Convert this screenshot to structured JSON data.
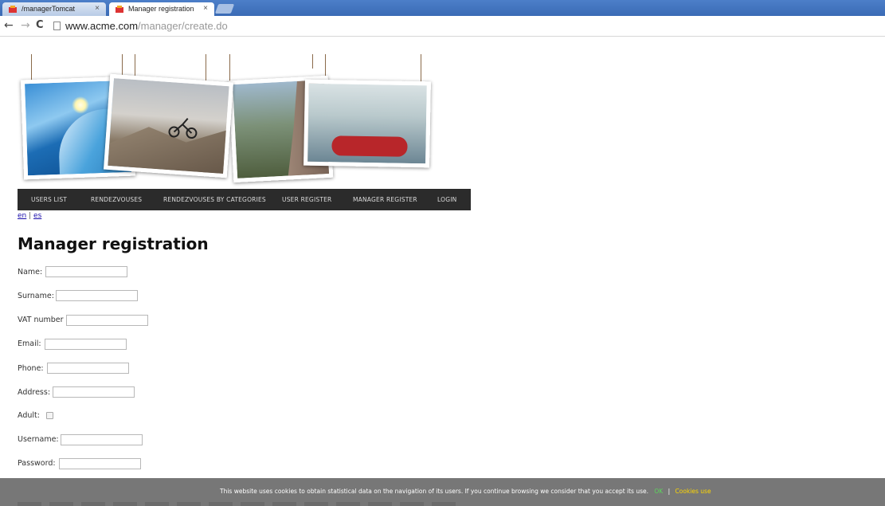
{
  "browser": {
    "tabs": [
      {
        "label": "/managerTomcat",
        "active": false
      },
      {
        "label": "Manager registration",
        "active": true
      }
    ],
    "close_glyph": "×",
    "url_host": "www.acme.com",
    "url_path": "/manager/create.do",
    "icons": {
      "back": "←",
      "forward": "→",
      "reload": "C"
    }
  },
  "menu": {
    "items": [
      {
        "label": "USERS LIST"
      },
      {
        "label": "RENDEZVOUSES"
      },
      {
        "label": "RENDEZVOUSES BY CATEGORIES"
      },
      {
        "label": "USER REGISTER"
      },
      {
        "label": "MANAGER REGISTER"
      },
      {
        "label": "LOGIN"
      }
    ]
  },
  "lang": {
    "en": "en",
    "separator": "|",
    "es": "es"
  },
  "page": {
    "title": "Manager registration"
  },
  "form": {
    "fields": [
      {
        "label": "Name:",
        "value": ""
      },
      {
        "label": "Surname:",
        "value": ""
      },
      {
        "label": "VAT number",
        "value": ""
      },
      {
        "label": "Email:",
        "value": ""
      },
      {
        "label": "Phone:",
        "value": ""
      },
      {
        "label": "Address:",
        "value": ""
      },
      {
        "label": "Adult:",
        "checked": false
      },
      {
        "label": "Username:",
        "value": ""
      },
      {
        "label": "Password:",
        "value": ""
      }
    ]
  },
  "cookies": {
    "message": "This website uses cookies to obtain statistical data on the navigation of its users. If you continue browsing we consider that you accept its use.",
    "ok_label": "OK",
    "separator": "|",
    "link_label": "Cookies use"
  },
  "colors": {
    "menu_bg": "#2b2b2b",
    "cookie_bg": "#777777",
    "cookie_ok": "#5cd65c",
    "cookie_link": "#ffd700"
  }
}
